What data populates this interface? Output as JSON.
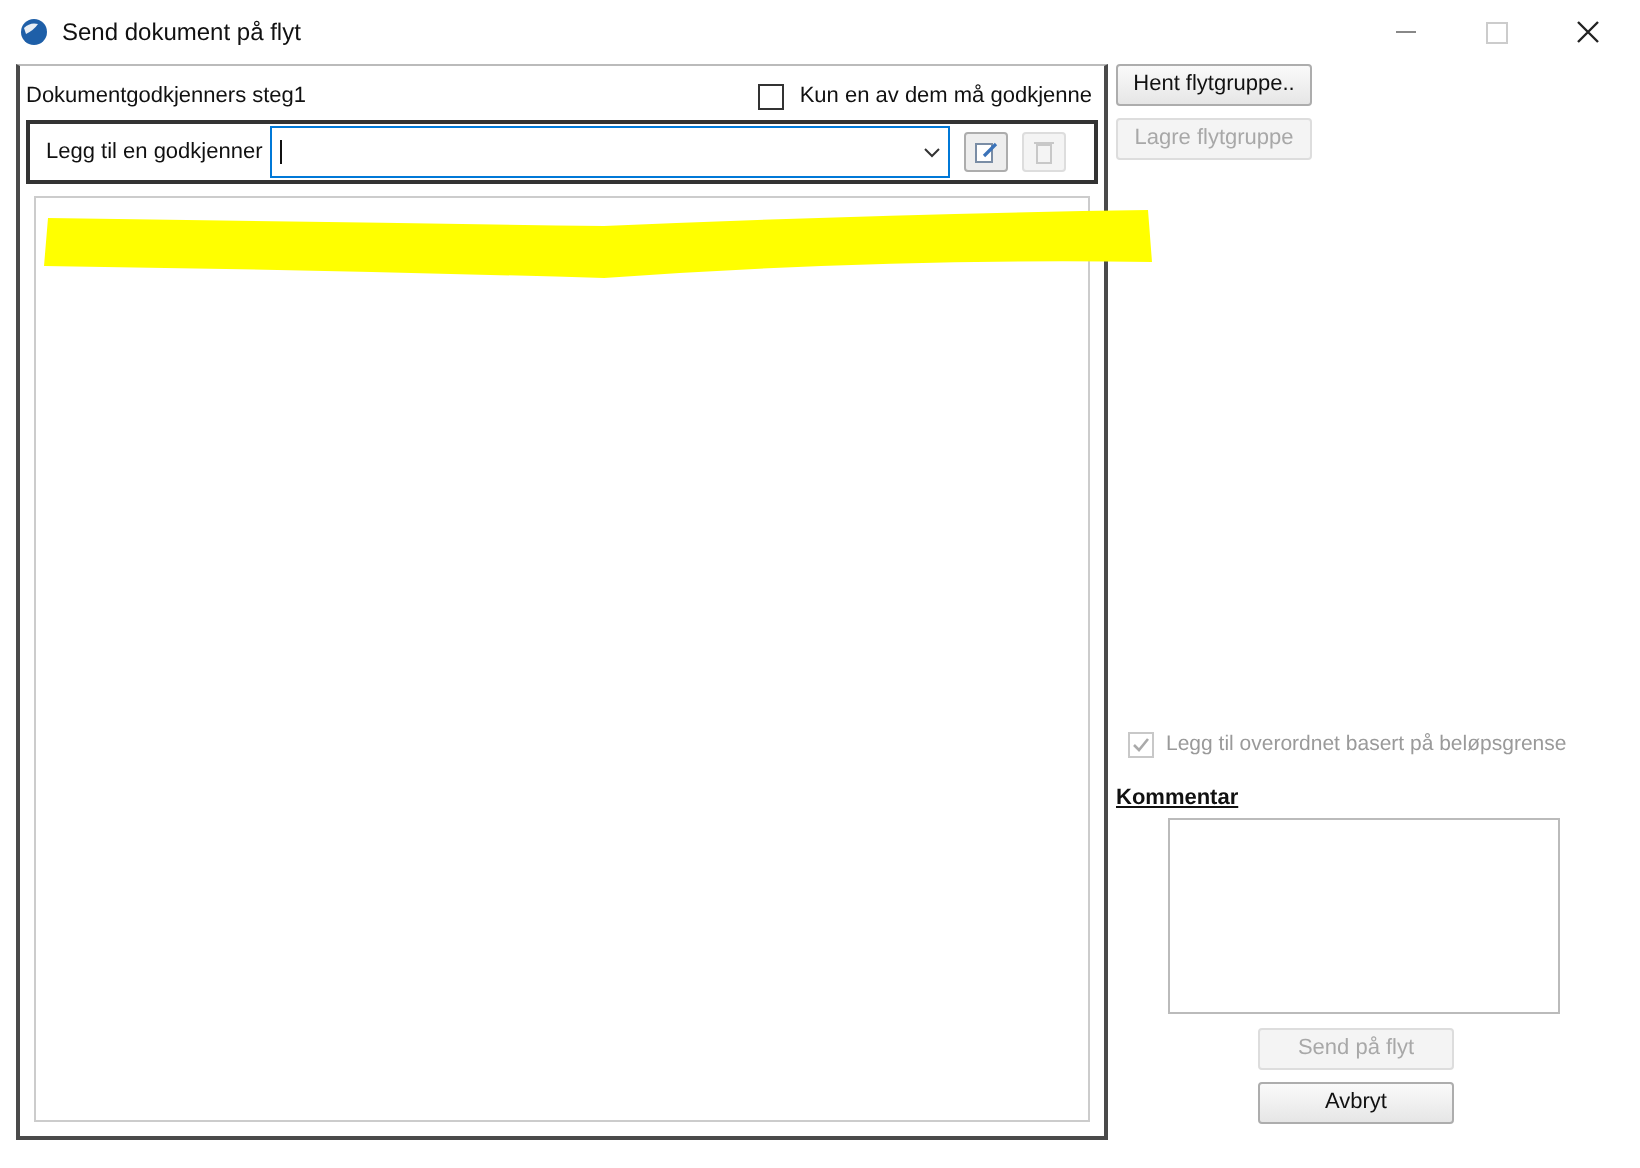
{
  "window": {
    "title": "Send dokument på flyt"
  },
  "approvers": {
    "step_title": "Dokumentgodkjenners steg1",
    "only_one": {
      "label": "Kun en av dem må godkjenne",
      "checked": false
    },
    "add_label": "Legg til en godkjenner",
    "combo": {
      "focused": true
    },
    "tools": [
      {
        "kind": "edit",
        "disabled": false
      },
      {
        "kind": "delete",
        "disabled": true
      }
    ]
  },
  "group_buttons": [
    {
      "label": "Hent flytgruppe..",
      "disabled": false
    },
    {
      "label": "Lagre flytgruppe",
      "disabled": true
    }
  ],
  "limit_checkbox": {
    "label": "Legg til overordnet basert på beløpsgrense",
    "checked": true,
    "disabled": true
  },
  "comment": {
    "label": "Kommentar"
  },
  "actions": [
    {
      "label": "Send på flyt",
      "disabled": true
    },
    {
      "label": "Avbryt",
      "disabled": false
    }
  ]
}
